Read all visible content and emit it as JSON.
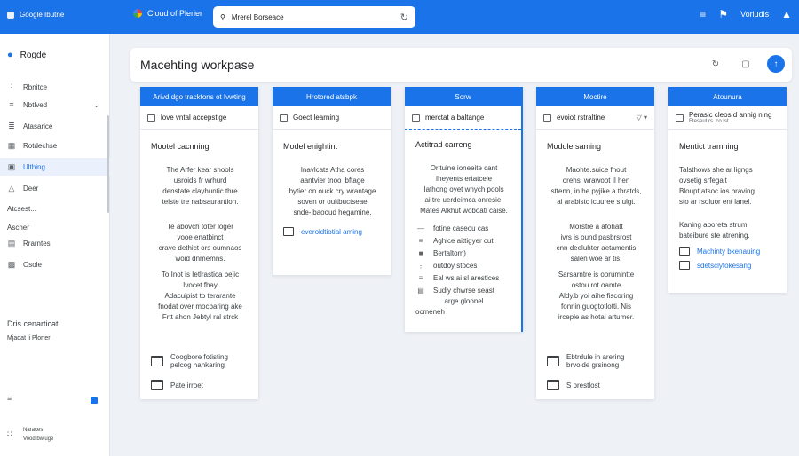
{
  "topbar": {
    "brand": "Google Ibutne",
    "project": "Cloud of Plerier",
    "search_value": "Mrerel Borseace",
    "account": "Vorludis"
  },
  "sidebar": {
    "project_name": "Rogde",
    "items": [
      {
        "icon": "grid-icon",
        "label": "Rbnitce"
      },
      {
        "icon": "list-icon",
        "label": "Nbtlved",
        "chevron": true
      },
      {
        "icon": "stack-icon",
        "label": "Atasarice"
      },
      {
        "icon": "table-icon",
        "label": "Rotdechse"
      },
      {
        "icon": "folder-icon",
        "label": "Ulthing",
        "active": true
      },
      {
        "icon": "triangle-icon",
        "label": "Deer"
      }
    ],
    "section1": "Atcsest...",
    "section2": "Ascher",
    "items2": [
      {
        "icon": "doc-icon",
        "label": "Rrarntes"
      },
      {
        "icon": "chart-icon",
        "label": "Osole"
      }
    ],
    "footer_title": "Dris cenarticat",
    "footer_sub": "Mjadat li Plorter",
    "bottom_title": "Naraces",
    "bottom_sub": "Vood bwiuge"
  },
  "workspace": {
    "title": "Macehting workpase"
  },
  "columns": [
    {
      "header": "Arivd dgo tracktons ot Ivwting",
      "sub": "love vntal accepstige",
      "heading": "Mootel cacnning",
      "para1": [
        "The Arfer kear shools",
        "usroids fr wrhurd",
        "denstate clayhuntic thre",
        "teiste tre nabsaurantion."
      ],
      "para2": [
        "Te abovch toter loger",
        "yooe enatbinct",
        "crave dethict ors oumnaos",
        "woid dnmemns."
      ],
      "para3": [
        "To Inot is Ietlrastica bejic",
        "Ivocet fhay",
        "Adacuipist to terarante",
        "fnodat over mocbaring ake",
        "Frtt ahon Jebtyl ral strck"
      ],
      "bottom": [
        {
          "label1": "Coogbore fotisting",
          "label2": "pelcog hankaring"
        },
        {
          "label1": "Pate irroet"
        }
      ]
    },
    {
      "header": "Hrotored atsbpk",
      "sub": "Goect learning",
      "heading": "Model enightint",
      "para1": [
        "Inavlcats Atha cores",
        "aantvier tnoo ibftage",
        "bytier on ouck cry wrantage",
        "soven or ouitbuctseae",
        "snde-ibaooud hegamine."
      ],
      "link": "everoldtiotial aming"
    },
    {
      "header": "Sorw",
      "sub": "merctat a baltange",
      "heading": "Actitrad carreng",
      "para1": [
        "Orituine ioneeite cant",
        "Iheyents ertatcele",
        "Iathong oyet wnych pools",
        "ai tre uerdeimca onresie.",
        "Mates Alkhut woboatl caise."
      ],
      "rows": [
        {
          "icon": "dash-icon",
          "label": "fotine caseou cas"
        },
        {
          "icon": "list-icon",
          "label": "Aghice aittigyer cut"
        },
        {
          "icon": "bars-icon",
          "label": "Bertaltom)"
        },
        {
          "icon": "dots-icon",
          "label": "outdoy stoces"
        },
        {
          "icon": "lines-icon",
          "label": "Eal ws ai sl arestices"
        },
        {
          "icon": "frame-icon",
          "label": "Sudly chwrse seast"
        }
      ],
      "tail": [
        "arge gloonel",
        "ocmeneh"
      ]
    },
    {
      "header": "Moctire",
      "sub": "evoiot rstraltine",
      "heading": "Modole saming",
      "para1": [
        "Maohte.suice fnout",
        "orehsl wrawoot Il hen",
        "sttenn, in he pyjike a tbratds,",
        "ai arabistc icuuree s ulgt."
      ],
      "para2": [
        "Morstre a afohatt",
        "ivrs is ound pasbrsrost",
        "cnn deeluhter aetamentis",
        "salen woe ar tis."
      ],
      "para3": [
        "Sarsarntre is oorumintte",
        "ostou rot oamte",
        "Aldy.b yoi aihe fiscoring",
        "fonr'in guogtotlotti. Nis",
        "irceple as hotal artumer."
      ],
      "bottom": [
        {
          "label1": "Ebtrdule in arering",
          "label2": "brvoide grsinong"
        },
        {
          "label1": "S prestlost"
        }
      ]
    },
    {
      "header": "Atounura",
      "sub": "Perasic cleos d annig ning",
      "sub2": "Eteseut rs. co.tst",
      "heading": "Mentict tramning",
      "para1": [
        "Talsthows she ar ligngs",
        "ovsetig srfegalt",
        "Bloupt atsoc ios braving",
        "sto ar rsoluor ent lanel."
      ],
      "para2": [
        "Kaning aporeta strum",
        "bateibure ste atrening."
      ],
      "links": [
        "Machinty bkenauing",
        "sdetsclyfokesang"
      ]
    }
  ],
  "colors": {
    "accent": "#1a73e8",
    "background": "#eef1f6"
  }
}
